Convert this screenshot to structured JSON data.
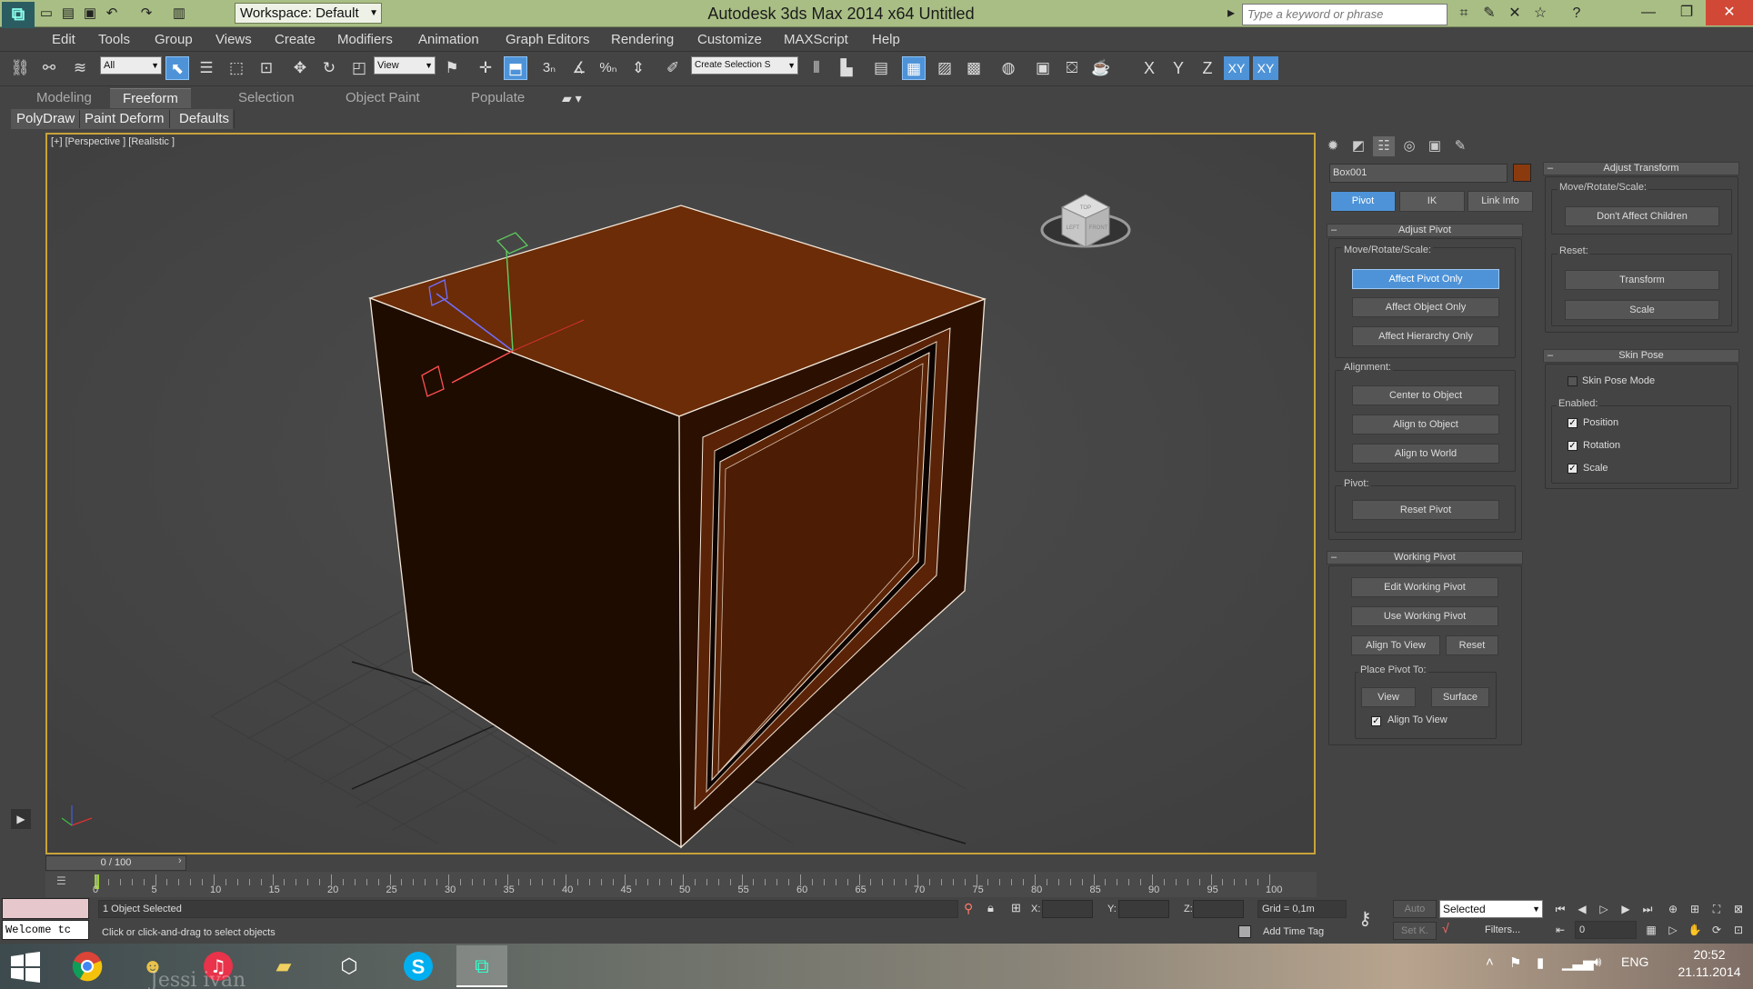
{
  "titlebar": {
    "workspace": "Workspace: Default",
    "title": "Autodesk 3ds Max  2014 x64      Untitled",
    "search_placeholder": "Type a keyword or phrase"
  },
  "menu": [
    "Edit",
    "Tools",
    "Group",
    "Views",
    "Create",
    "Modifiers",
    "Animation",
    "Graph Editors",
    "Rendering",
    "Customize",
    "MAXScript",
    "Help"
  ],
  "toolbar": {
    "selection_filter": "All",
    "ref_coord": "View",
    "snap_labels": [
      "3",
      "%"
    ],
    "named_selection": "Create Selection S",
    "axes": [
      "X",
      "Y",
      "Z",
      "XY",
      "XY"
    ]
  },
  "ribbon": {
    "tabs": [
      "Modeling",
      "Freeform",
      "Selection",
      "Object Paint",
      "Populate"
    ],
    "active": "Freeform",
    "sub": [
      "PolyDraw",
      "Paint Deform",
      "Defaults"
    ]
  },
  "viewport": {
    "label": "[+] [Perspective ] [Realistic ]",
    "viewcube_faces": [
      "TOP",
      "LEFT",
      "FRONT"
    ]
  },
  "panel": {
    "object_name": "Box001",
    "object_color": "#8b3a0e",
    "hier_tabs": [
      "Pivot",
      "IK",
      "Link Info"
    ],
    "adjust_pivot": {
      "title": "Adjust Pivot",
      "move_label": "Move/Rotate/Scale:",
      "buttons": [
        "Affect Pivot Only",
        "Affect Object Only",
        "Affect Hierarchy Only"
      ],
      "alignment_label": "Alignment:",
      "align_buttons": [
        "Center to Object",
        "Align to Object",
        "Align to World"
      ],
      "pivot_label": "Pivot:",
      "reset_pivot": "Reset Pivot"
    },
    "working_pivot": {
      "title": "Working Pivot",
      "edit": "Edit Working Pivot",
      "use": "Use Working Pivot",
      "align_view": "Align To View",
      "reset": "Reset",
      "place_label": "Place Pivot To:",
      "view": "View",
      "surface": "Surface",
      "align_to_view_chk": "Align To View"
    },
    "adjust_transform": {
      "title": "Adjust Transform",
      "move_label": "Move/Rotate/Scale:",
      "dont_affect": "Don't Affect Children",
      "reset_label": "Reset:",
      "transform": "Transform",
      "scale": "Scale"
    },
    "skin_pose": {
      "title": "Skin Pose",
      "mode": "Skin Pose Mode",
      "enabled_label": "Enabled:",
      "position": "Position",
      "rotation": "Rotation",
      "scale": "Scale"
    }
  },
  "timeline": {
    "slider": "0 / 100",
    "ticks": [
      "0",
      "5",
      "10",
      "15",
      "20",
      "25",
      "30",
      "35",
      "40",
      "45",
      "50",
      "55",
      "60",
      "65",
      "70",
      "75",
      "80",
      "85",
      "90",
      "95",
      "100"
    ]
  },
  "status": {
    "selected": "1 Object Selected",
    "prompt": "Click or click-and-drag to select objects",
    "maxscript": "Welcome tc",
    "x_label": "X:",
    "y_label": "Y:",
    "z_label": "Z:",
    "grid": "Grid = 0,1m",
    "add_time_tag": "Add Time Tag",
    "auto": "Auto",
    "setk": "Set K.",
    "key_filter": "Selected",
    "filters": "Filters...",
    "frame": "0"
  },
  "taskbar": {
    "lang": "ENG",
    "time": "20:52",
    "date": "21.11.2014",
    "watermark": "Jessi ivan"
  }
}
